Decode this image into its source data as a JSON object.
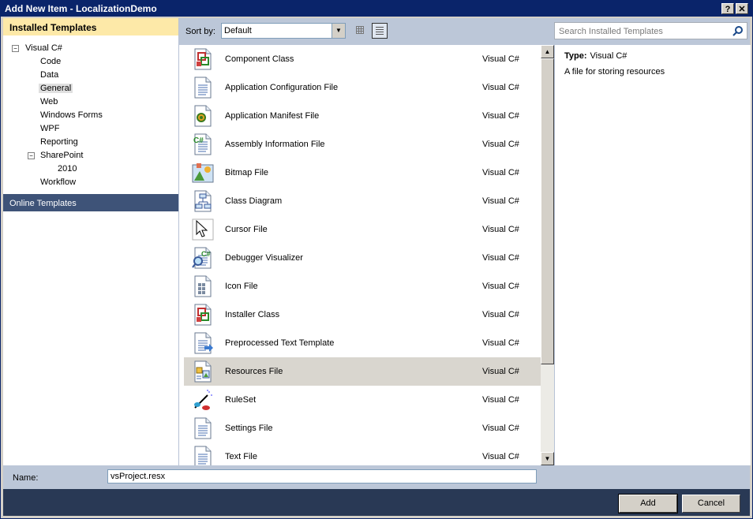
{
  "window": {
    "title": "Add New Item - LocalizationDemo",
    "help_glyph": "?",
    "close_glyph": "✕"
  },
  "left_pane": {
    "installed_header": "Installed Templates",
    "tree": [
      {
        "label": "Visual C#",
        "toggle": "−"
      },
      {
        "label": "Code"
      },
      {
        "label": "Data"
      },
      {
        "label": "General",
        "selected": true
      },
      {
        "label": "Web"
      },
      {
        "label": "Windows Forms"
      },
      {
        "label": "WPF"
      },
      {
        "label": "Reporting"
      },
      {
        "label": "SharePoint",
        "toggle": "−"
      },
      {
        "label": "2010"
      },
      {
        "label": "Workflow"
      }
    ],
    "online_header": "Online Templates"
  },
  "toolbar": {
    "sort_label": "Sort by:",
    "sort_value": "Default",
    "search_placeholder": "Search Installed Templates"
  },
  "templates": [
    {
      "name": "Component Class",
      "lang": "Visual C#",
      "icon": "component-class-icon"
    },
    {
      "name": "Application Configuration File",
      "lang": "Visual C#",
      "icon": "config-file-icon"
    },
    {
      "name": "Application Manifest File",
      "lang": "Visual C#",
      "icon": "manifest-file-icon"
    },
    {
      "name": "Assembly Information File",
      "lang": "Visual C#",
      "icon": "csharp-file-icon"
    },
    {
      "name": "Bitmap File",
      "lang": "Visual C#",
      "icon": "bitmap-icon"
    },
    {
      "name": "Class Diagram",
      "lang": "Visual C#",
      "icon": "class-diagram-icon"
    },
    {
      "name": "Cursor File",
      "lang": "Visual C#",
      "icon": "cursor-icon"
    },
    {
      "name": "Debugger Visualizer",
      "lang": "Visual C#",
      "icon": "debugger-visualizer-icon"
    },
    {
      "name": "Icon File",
      "lang": "Visual C#",
      "icon": "icon-file-icon"
    },
    {
      "name": "Installer Class",
      "lang": "Visual C#",
      "icon": "installer-class-icon"
    },
    {
      "name": "Preprocessed Text Template",
      "lang": "Visual C#",
      "icon": "text-template-icon"
    },
    {
      "name": "Resources File",
      "lang": "Visual C#",
      "icon": "resources-file-icon",
      "selected": true
    },
    {
      "name": "RuleSet",
      "lang": "Visual C#",
      "icon": "ruleset-icon"
    },
    {
      "name": "Settings File",
      "lang": "Visual C#",
      "icon": "settings-file-icon"
    },
    {
      "name": "Text File",
      "lang": "Visual C#",
      "icon": "text-file-icon"
    }
  ],
  "details": {
    "type_label": "Type:",
    "type_value": "Visual C#",
    "description": "A file for storing resources"
  },
  "bottom": {
    "name_label": "Name:",
    "name_value": "vsProject.resx",
    "add_label": "Add",
    "cancel_label": "Cancel"
  }
}
